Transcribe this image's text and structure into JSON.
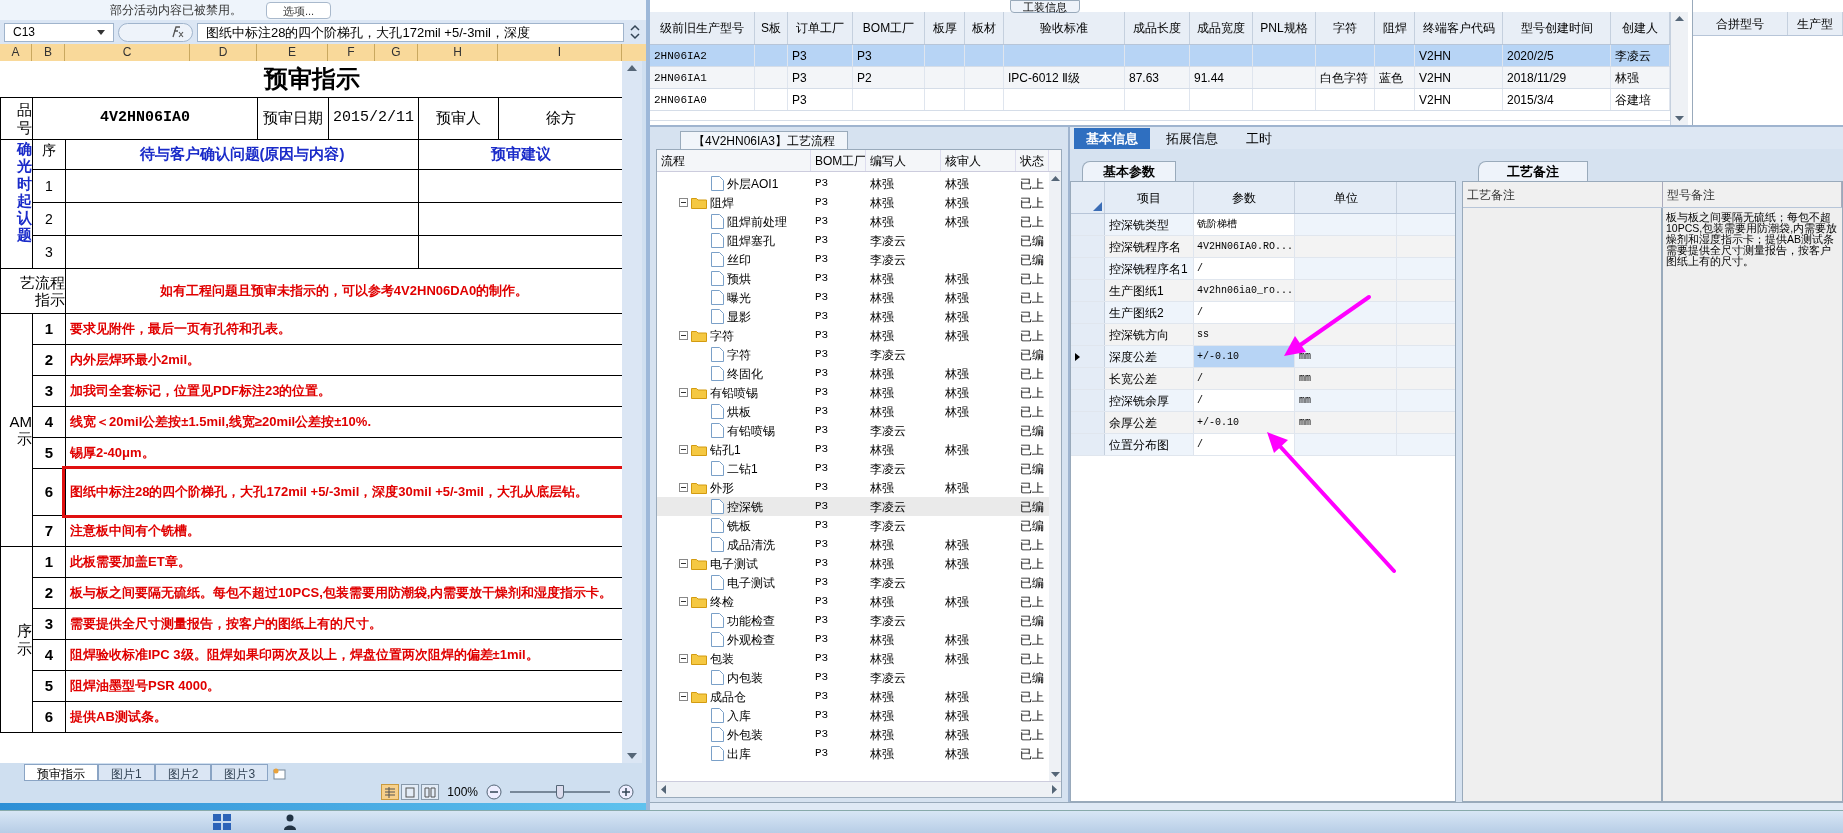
{
  "excel": {
    "security_bar": {
      "message": "部分活动内容已被禁用。",
      "button": "选项..."
    },
    "name_box": "C13",
    "formula": "图纸中标注28的四个阶梯孔，大孔172mil +5/-3mil，深度",
    "columns": [
      "A",
      "B",
      "C",
      "D",
      "E",
      "F",
      "G",
      "H",
      "I"
    ],
    "title": "预审指示",
    "header": {
      "label_lines": [
        "品",
        "号"
      ],
      "product": "4V2HN06IA0",
      "date_label": "预审日期",
      "date": "2015/2/11",
      "reviewer_label": "预审人",
      "reviewer": "徐方"
    },
    "confirm": {
      "label_lines": [
        "确",
        "光",
        "时",
        "起",
        "认",
        "题"
      ],
      "seq_header": "序",
      "issue_header": "待与客户确认问题(原因与内容)",
      "advice_header": "预审建议",
      "rows": [
        "1",
        "2",
        "3"
      ]
    },
    "process_note": {
      "label_lines": [
        "艺流程",
        "指示"
      ],
      "text": "如有工程问题且预审未指示的，可以参考4V2HN06DA0的制作。"
    },
    "sections": [
      {
        "label_lines": [
          "AM",
          "示"
        ],
        "rows": [
          {
            "no": "1",
            "text": "要求见附件，最后一页有孔符和孔表。",
            "highlighted": false
          },
          {
            "no": "2",
            "text": "内外层焊环最小2mil。",
            "highlighted": false
          },
          {
            "no": "3",
            "text": "加我司全套标记，位置见PDF标注23的位置。",
            "highlighted": false
          },
          {
            "no": "4",
            "text": "线宽＜20mil公差按±1.5mil,线宽≥20mil公差按±10%.",
            "highlighted": false
          },
          {
            "no": "5",
            "text": "锡厚2-40μm。",
            "highlighted": false
          },
          {
            "no": "6",
            "text": "图纸中标注28的四个阶梯孔，大孔172mil +5/-3mil，深度30mil +5/-3mil，大孔从底层钻。",
            "highlighted": true
          },
          {
            "no": "7",
            "text": "注意板中间有个铣槽。",
            "highlighted": false
          }
        ]
      },
      {
        "label_lines": [
          "序",
          "示"
        ],
        "rows": [
          {
            "no": "1",
            "text": "此板需要加盖ET章。",
            "highlighted": false
          },
          {
            "no": "2",
            "text": "板与板之间要隔无硫纸。每包不超过10PCS,包装需要用防潮袋,内需要放干燥剂和湿度指示卡。",
            "highlighted": false
          },
          {
            "no": "3",
            "text": "需要提供全尺寸测量报告，按客户的图纸上有的尺寸。",
            "highlighted": false
          },
          {
            "no": "4",
            "text": "阻焊验收标准IPC 3级。阻焊如果印两次及以上，焊盘位置两次阻焊的偏差±1mil。",
            "highlighted": false
          },
          {
            "no": "5",
            "text": "阻焊油墨型号PSR 4000。",
            "highlighted": false
          },
          {
            "no": "6",
            "text": "提供AB测试条。",
            "highlighted": false
          }
        ]
      }
    ],
    "sheet_tabs": [
      {
        "label": "预审指示",
        "selected": true
      },
      {
        "label": "图片1",
        "selected": false
      },
      {
        "label": "图片2",
        "selected": false
      },
      {
        "label": "图片3",
        "selected": false
      }
    ],
    "view_buttons": [
      {
        "kind": "normal",
        "selected": true
      },
      {
        "kind": "page_layout",
        "selected": false
      },
      {
        "kind": "page_break",
        "selected": false
      }
    ],
    "zoom": "100%",
    "zoom_slider": {
      "level": 0.5
    }
  },
  "model_table": {
    "tab": "工装信息",
    "columns": [
      "级前旧生产型号",
      "S板",
      "订单工厂",
      "BOM工厂",
      "板厚",
      "板材",
      "验收标准",
      "成品长度",
      "成品宽度",
      "PNL规格",
      "字符",
      "阻焊",
      "终端客户代码",
      "型号创建时间",
      "创建人"
    ],
    "rows": [
      {
        "selected": true,
        "cells": [
          "2HN06IA2",
          null,
          "P3",
          "P3",
          null,
          null,
          null,
          null,
          null,
          null,
          null,
          null,
          "V2HN",
          "2020/2/5",
          "李凌云"
        ]
      },
      {
        "selected": false,
        "cells": [
          "2HN06IA1",
          null,
          "P3",
          "P2",
          null,
          null,
          "IPC-6012 Ⅱ级",
          "87.63",
          "91.44",
          null,
          "白色字符",
          "蓝色",
          "V2HN",
          "2018/11/29",
          "林强"
        ]
      },
      {
        "selected": false,
        "cells": [
          "2HN06IA0",
          null,
          "P3",
          null,
          null,
          null,
          null,
          null,
          null,
          null,
          null,
          null,
          "V2HN",
          "2015/3/4",
          "谷建培"
        ]
      }
    ]
  },
  "merge_table": {
    "columns": [
      "合拼型号",
      "生产型"
    ]
  },
  "process_flow": {
    "tab": "【4V2HN06IA3】工艺流程",
    "columns": [
      "流程",
      "BOM工厂",
      "编写人",
      "核审人",
      "状态"
    ],
    "nodes": [
      {
        "kind": "leaf",
        "label": "外层AOI1",
        "bom": "P3",
        "writer": "林强",
        "reviewer": "林强",
        "status": "已上",
        "selected": false
      },
      {
        "kind": "folder",
        "label": "阻焊",
        "bom": "P3",
        "writer": "林强",
        "reviewer": "林强",
        "status": "已上",
        "selected": false,
        "children": [
          {
            "kind": "leaf",
            "label": "阻焊前处理",
            "bom": "P3",
            "writer": "林强",
            "reviewer": "林强",
            "status": "已上",
            "selected": false
          },
          {
            "kind": "leaf",
            "label": "阻焊塞孔",
            "bom": "P3",
            "writer": "李凌云",
            "status": "已编",
            "selected": false
          },
          {
            "kind": "leaf",
            "label": "丝印",
            "bom": "P3",
            "writer": "李凌云",
            "status": "已编",
            "selected": false
          },
          {
            "kind": "leaf",
            "label": "预烘",
            "bom": "P3",
            "writer": "林强",
            "reviewer": "林强",
            "status": "已上",
            "selected": false
          },
          {
            "kind": "leaf",
            "label": "曝光",
            "bom": "P3",
            "writer": "林强",
            "reviewer": "林强",
            "status": "已上",
            "selected": false
          },
          {
            "kind": "leaf",
            "label": "显影",
            "bom": "P3",
            "writer": "林强",
            "reviewer": "林强",
            "status": "已上",
            "selected": false
          }
        ]
      },
      {
        "kind": "folder",
        "label": "字符",
        "bom": "P3",
        "writer": "林强",
        "reviewer": "林强",
        "status": "已上",
        "selected": false,
        "children": [
          {
            "kind": "leaf",
            "label": "字符",
            "bom": "P3",
            "writer": "李凌云",
            "status": "已编",
            "selected": false
          },
          {
            "kind": "leaf",
            "label": "终固化",
            "bom": "P3",
            "writer": "林强",
            "reviewer": "林强",
            "status": "已上",
            "selected": false
          }
        ]
      },
      {
        "kind": "folder",
        "label": "有铅喷锡",
        "bom": "P3",
        "writer": "林强",
        "reviewer": "林强",
        "status": "已上",
        "selected": false,
        "children": [
          {
            "kind": "leaf",
            "label": "烘板",
            "bom": "P3",
            "writer": "林强",
            "reviewer": "林强",
            "status": "已上",
            "selected": false
          },
          {
            "kind": "leaf",
            "label": "有铅喷锡",
            "bom": "P3",
            "writer": "李凌云",
            "status": "已编",
            "selected": false
          }
        ]
      },
      {
        "kind": "folder",
        "label": "钻孔1",
        "bom": "P3",
        "writer": "林强",
        "reviewer": "林强",
        "status": "已上",
        "selected": false,
        "children": [
          {
            "kind": "leaf",
            "label": "二钻1",
            "bom": "P3",
            "writer": "李凌云",
            "status": "已编",
            "selected": false
          }
        ]
      },
      {
        "kind": "folder",
        "label": "外形",
        "bom": "P3",
        "writer": "林强",
        "reviewer": "林强",
        "status": "已上",
        "selected": false,
        "children": [
          {
            "kind": "leaf",
            "label": "控深铣",
            "bom": "P3",
            "writer": "李凌云",
            "status": "已编",
            "selected": true
          },
          {
            "kind": "leaf",
            "label": "铣板",
            "bom": "P3",
            "writer": "李凌云",
            "status": "已编",
            "selected": false
          },
          {
            "kind": "leaf",
            "label": "成品清洗",
            "bom": "P3",
            "writer": "林强",
            "reviewer": "林强",
            "status": "已上",
            "selected": false
          }
        ]
      },
      {
        "kind": "folder",
        "label": "电子测试",
        "bom": "P3",
        "writer": "林强",
        "reviewer": "林强",
        "status": "已上",
        "selected": false,
        "children": [
          {
            "kind": "leaf",
            "label": "电子测试",
            "bom": "P3",
            "writer": "李凌云",
            "status": "已编",
            "selected": false
          }
        ]
      },
      {
        "kind": "folder",
        "label": "终检",
        "bom": "P3",
        "writer": "林强",
        "reviewer": "林强",
        "status": "已上",
        "selected": false,
        "children": [
          {
            "kind": "leaf",
            "label": "功能检查",
            "bom": "P3",
            "writer": "李凌云",
            "status": "已编",
            "selected": false
          },
          {
            "kind": "leaf",
            "label": "外观检查",
            "bom": "P3",
            "writer": "林强",
            "reviewer": "林强",
            "status": "已上",
            "selected": false
          }
        ]
      },
      {
        "kind": "folder",
        "label": "包装",
        "bom": "P3",
        "writer": "林强",
        "reviewer": "林强",
        "status": "已上",
        "selected": false,
        "children": [
          {
            "kind": "leaf",
            "label": "内包装",
            "bom": "P3",
            "writer": "李凌云",
            "status": "已编",
            "selected": false
          }
        ]
      },
      {
        "kind": "folder",
        "label": "成品仓",
        "bom": "P3",
        "writer": "林强",
        "reviewer": "林强",
        "status": "已上",
        "selected": false,
        "children": [
          {
            "kind": "leaf",
            "label": "入库",
            "bom": "P3",
            "writer": "林强",
            "reviewer": "林强",
            "status": "已上",
            "selected": false
          },
          {
            "kind": "leaf",
            "label": "外包装",
            "bom": "P3",
            "writer": "林强",
            "reviewer": "林强",
            "status": "已上",
            "selected": false
          },
          {
            "kind": "leaf",
            "label": "出库",
            "bom": "P3",
            "writer": "林强",
            "reviewer": "林强",
            "status": "已上",
            "selected": false
          }
        ]
      }
    ]
  },
  "detail_tabs": [
    {
      "label": "基本信息",
      "selected": true
    },
    {
      "label": "拓展信息",
      "selected": false
    },
    {
      "label": "工时",
      "selected": false
    }
  ],
  "basic_params": {
    "tab": "基本参数",
    "columns": [
      "项目",
      "参数",
      "单位"
    ],
    "rows": [
      {
        "item": "控深铣类型",
        "value": "铣阶梯槽",
        "selected": false
      },
      {
        "item": "控深铣程序名",
        "value": "4V2HN06IA0.RO...",
        "selected": false
      },
      {
        "item": "控深铣程序名1",
        "value": "/",
        "selected": false
      },
      {
        "item": "生产图纸1",
        "value": "4v2hn06ia0_ro...",
        "selected": false
      },
      {
        "item": "生产图纸2",
        "value": "/",
        "selected": false
      },
      {
        "item": "控深铣方向",
        "value": "ss",
        "selected": false
      },
      {
        "item": "深度公差",
        "value": "+/-0.10",
        "unit": "mm",
        "selected": true
      },
      {
        "item": "长宽公差",
        "value": "/",
        "unit": "mm",
        "selected": false
      },
      {
        "item": "控深铣余厚",
        "value": "/",
        "unit": "mm",
        "selected": false
      },
      {
        "item": "余厚公差",
        "value": "+/-0.10",
        "unit": "mm",
        "selected": false
      },
      {
        "item": "位置分布图",
        "value": "/",
        "selected": false
      }
    ]
  },
  "process_notes": {
    "tab": "工艺备注",
    "columns": [
      "工艺备注",
      "型号备注"
    ],
    "model_note_lines": [
      "板与板之间要隔无硫纸；每包不超",
      "10PCS,包装需要用防潮袋,内需要放",
      "燥剂和湿度指示卡；提供AB测试条",
      "需要提供全尺寸测量报告，按客户",
      "图纸上有的尺寸。"
    ]
  }
}
